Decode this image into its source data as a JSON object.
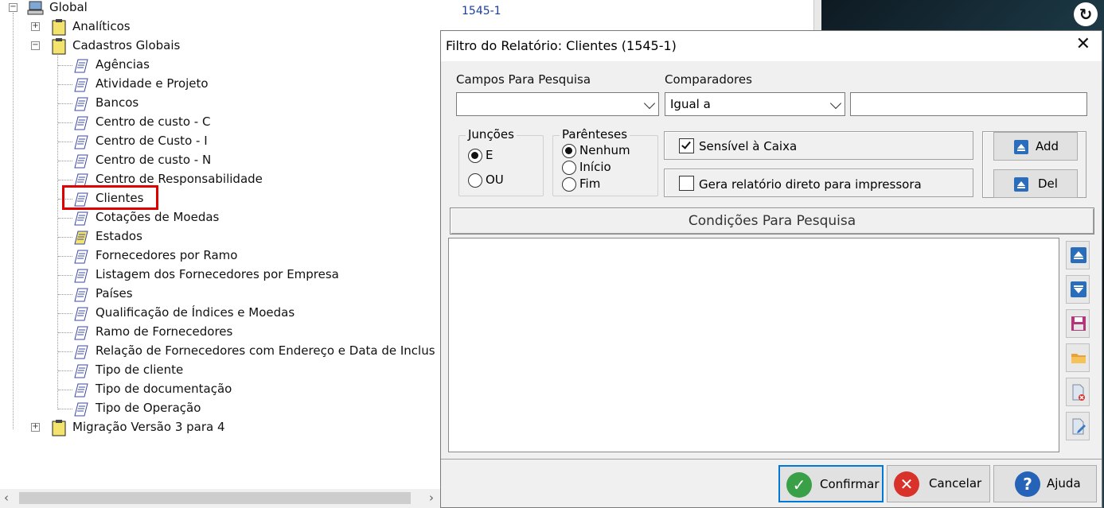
{
  "tree": {
    "root": "Global",
    "items": [
      {
        "label": "Analíticos"
      },
      {
        "label": "Cadastros Globais"
      },
      {
        "label": "Agências"
      },
      {
        "label": "Atividade e Projeto"
      },
      {
        "label": "Bancos"
      },
      {
        "label": "Centro de custo - C"
      },
      {
        "label": "Centro de Custo - I"
      },
      {
        "label": "Centro de custo - N"
      },
      {
        "label": "Centro de Responsabilidade"
      },
      {
        "label": "Clientes"
      },
      {
        "label": "Cotações de Moedas"
      },
      {
        "label": "Estados"
      },
      {
        "label": "Fornecedores por Ramo"
      },
      {
        "label": "Listagem dos Fornecedores por Empresa"
      },
      {
        "label": "Países"
      },
      {
        "label": "Qualificação de Índices e Moedas"
      },
      {
        "label": "Ramo de Fornecedores"
      },
      {
        "label": "Relação de Fornecedores com Endereço e Data de Inclus"
      },
      {
        "label": "Tipo de cliente"
      },
      {
        "label": "Tipo de documentação"
      },
      {
        "label": "Tipo de Operação"
      },
      {
        "label": "Migração Versão 3 para 4"
      }
    ]
  },
  "background": {
    "code": "1545-1"
  },
  "dialog": {
    "title": "Filtro do Relatório: Clientes (1545-1)",
    "close_glyph": "✕",
    "campos_label": "Campos Para Pesquisa",
    "campos_value": "",
    "comparadores_label": "Comparadores",
    "comparadores_value": "Igual a",
    "value_input": "",
    "juncoes": {
      "title": "Junções",
      "options": [
        "E",
        "OU"
      ],
      "selected": "E"
    },
    "parenteses": {
      "title": "Parênteses",
      "options": [
        "Nenhum",
        "Início",
        "Fim"
      ],
      "selected": "Nenhum"
    },
    "sensivel_label": "Sensível à Caixa",
    "sensivel_checked": true,
    "gera_label": "Gera relatório direto para impressora",
    "gera_checked": false,
    "add_label": "Add",
    "del_label": "Del",
    "condicoes_header": "Condições Para Pesquisa",
    "confirmar_label": "Confirmar",
    "cancelar_label": "Cancelar",
    "ajuda_label": "Ajuda"
  },
  "colors": {
    "accent": "#0078d7",
    "highlight": "#e00000",
    "confirm": "#3aa047",
    "cancel": "#d8322a",
    "help": "#2463b8"
  }
}
